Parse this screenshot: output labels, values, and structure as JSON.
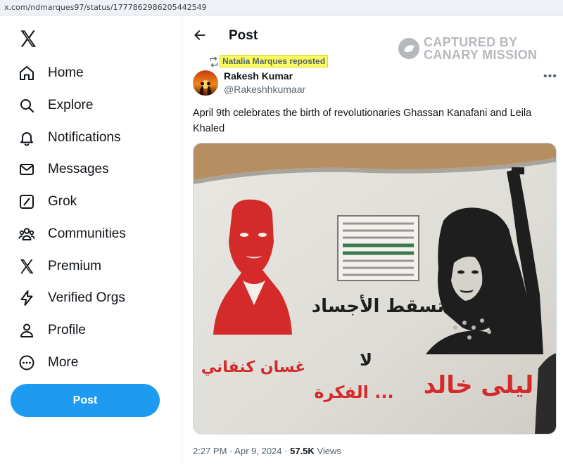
{
  "browser": {
    "url": "x.com/ndmarques97/status/1777862986205442549"
  },
  "sidebar": {
    "logo": "x-logo-icon",
    "items": [
      {
        "label": "Home",
        "icon": "home-icon"
      },
      {
        "label": "Explore",
        "icon": "search-icon"
      },
      {
        "label": "Notifications",
        "icon": "bell-icon"
      },
      {
        "label": "Messages",
        "icon": "envelope-icon"
      },
      {
        "label": "Grok",
        "icon": "grok-icon"
      },
      {
        "label": "Communities",
        "icon": "people-icon"
      },
      {
        "label": "Premium",
        "icon": "x-premium-icon"
      },
      {
        "label": "Verified Orgs",
        "icon": "lightning-icon"
      },
      {
        "label": "Profile",
        "icon": "person-icon"
      },
      {
        "label": "More",
        "icon": "more-circle-icon"
      }
    ],
    "post_button": "Post"
  },
  "header": {
    "title": "Post"
  },
  "watermark": {
    "line1": "CAPTURED BY",
    "line2": "CANARY MISSION"
  },
  "tweet": {
    "repost_label": "Natalia Marques reposted",
    "author_name": "Rakesh Kumar",
    "author_handle": "@Rakeshhkumaar",
    "text": "April 9th celebrates the birth of revolutionaries  Ghassan Kanafani and Leila Khaled",
    "media": {
      "left_caption": "غسان كنفاني",
      "center_line1": "تسقط الأجساد",
      "center_line2": "لا",
      "center_line3": "الفكرة ...",
      "right_caption": "ليلى خالد"
    },
    "time": "2:27 PM",
    "date": "Apr 9, 2024",
    "views_count": "57.5K",
    "views_label": "Views"
  },
  "colors": {
    "accent": "#1d9bf0",
    "highlight": "#fbfb5c",
    "muted": "#536471",
    "stencil_red": "#d42a2a"
  }
}
